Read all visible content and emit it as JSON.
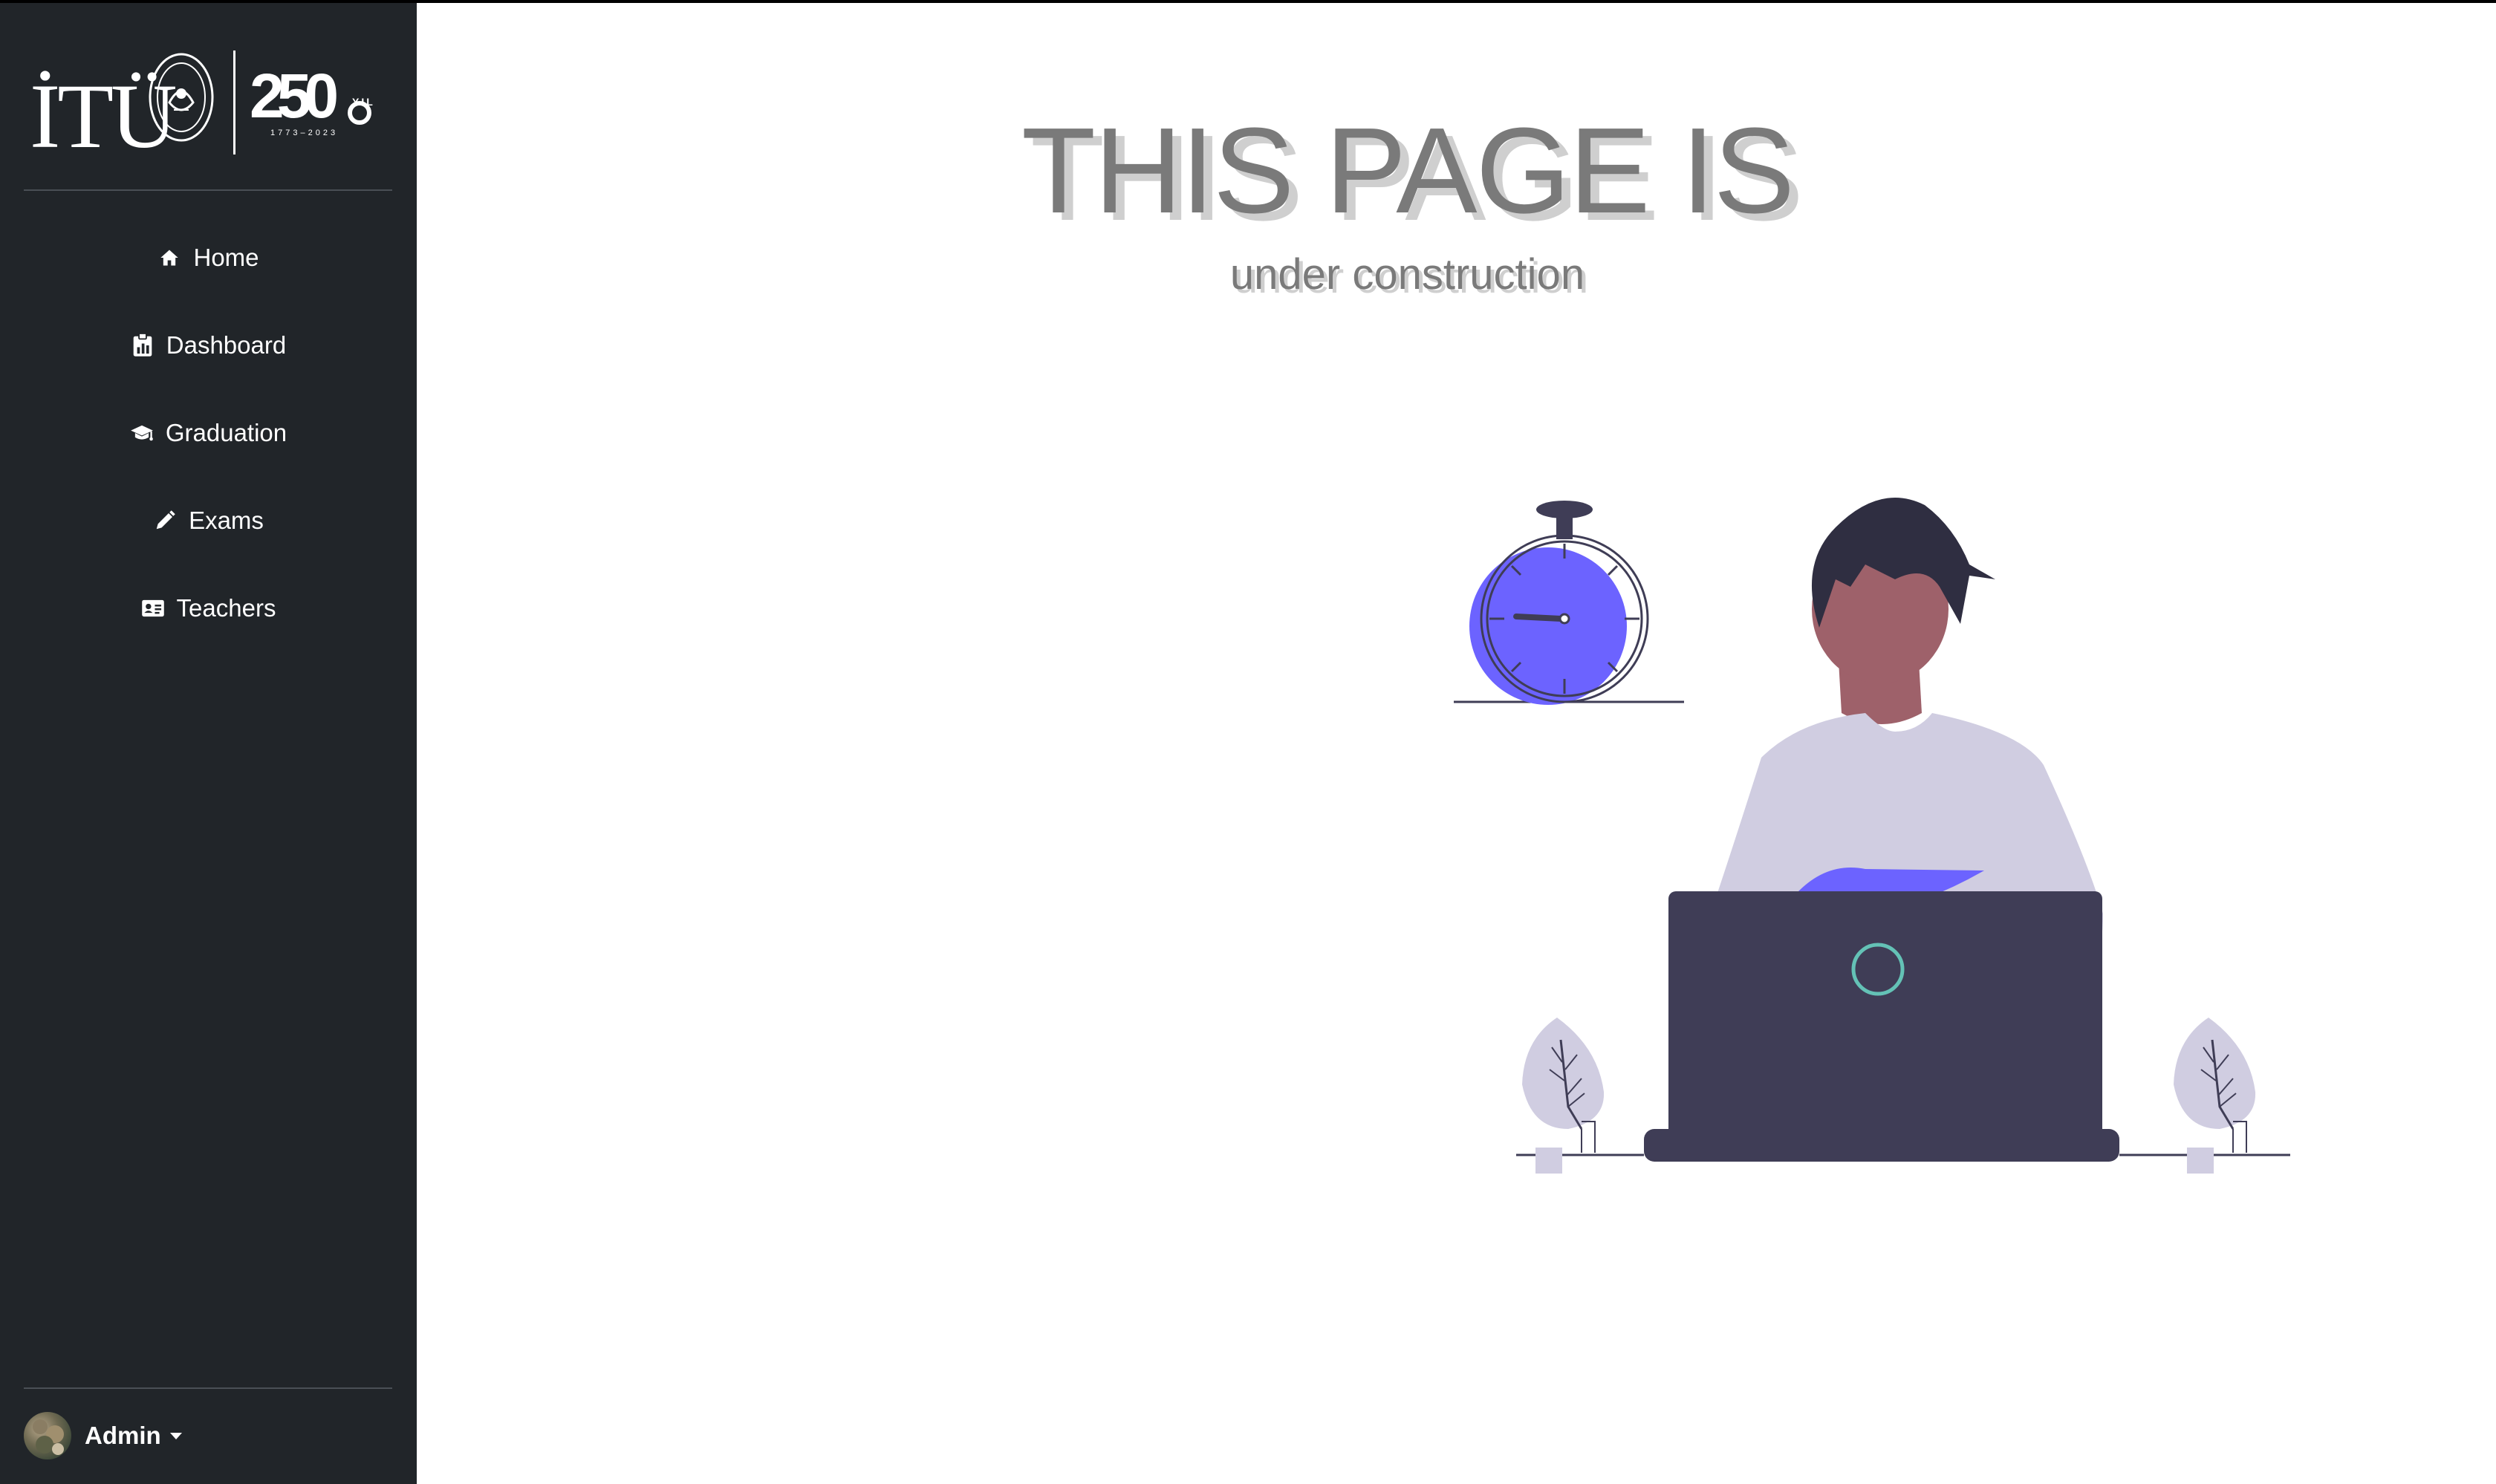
{
  "sidebar": {
    "brand": {
      "logo_text": "İTÜ",
      "anniversary_number": "250",
      "anniversary_suffix": "YIL",
      "anniversary_years": "1773–2023"
    },
    "items": [
      {
        "label": "Home",
        "icon": "home-icon"
      },
      {
        "label": "Dashboard",
        "icon": "clipboard-chart-icon"
      },
      {
        "label": "Graduation",
        "icon": "graduation-cap-icon"
      },
      {
        "label": "Exams",
        "icon": "pencil-icon"
      },
      {
        "label": "Teachers",
        "icon": "id-card-icon"
      }
    ],
    "user": {
      "name": "Admin",
      "menu_icon": "caret-down-icon"
    }
  },
  "main": {
    "headline": "THIS PAGE IS",
    "subline": "under construction",
    "illustration": "person-at-laptop-with-stopwatch"
  },
  "colors": {
    "sidebar_bg": "#212529",
    "accent_purple": "#6c63ff",
    "dark_ink": "#3f3d56",
    "text_gray": "#7a7a7a",
    "shadow_gray": "#cfcfcf"
  }
}
